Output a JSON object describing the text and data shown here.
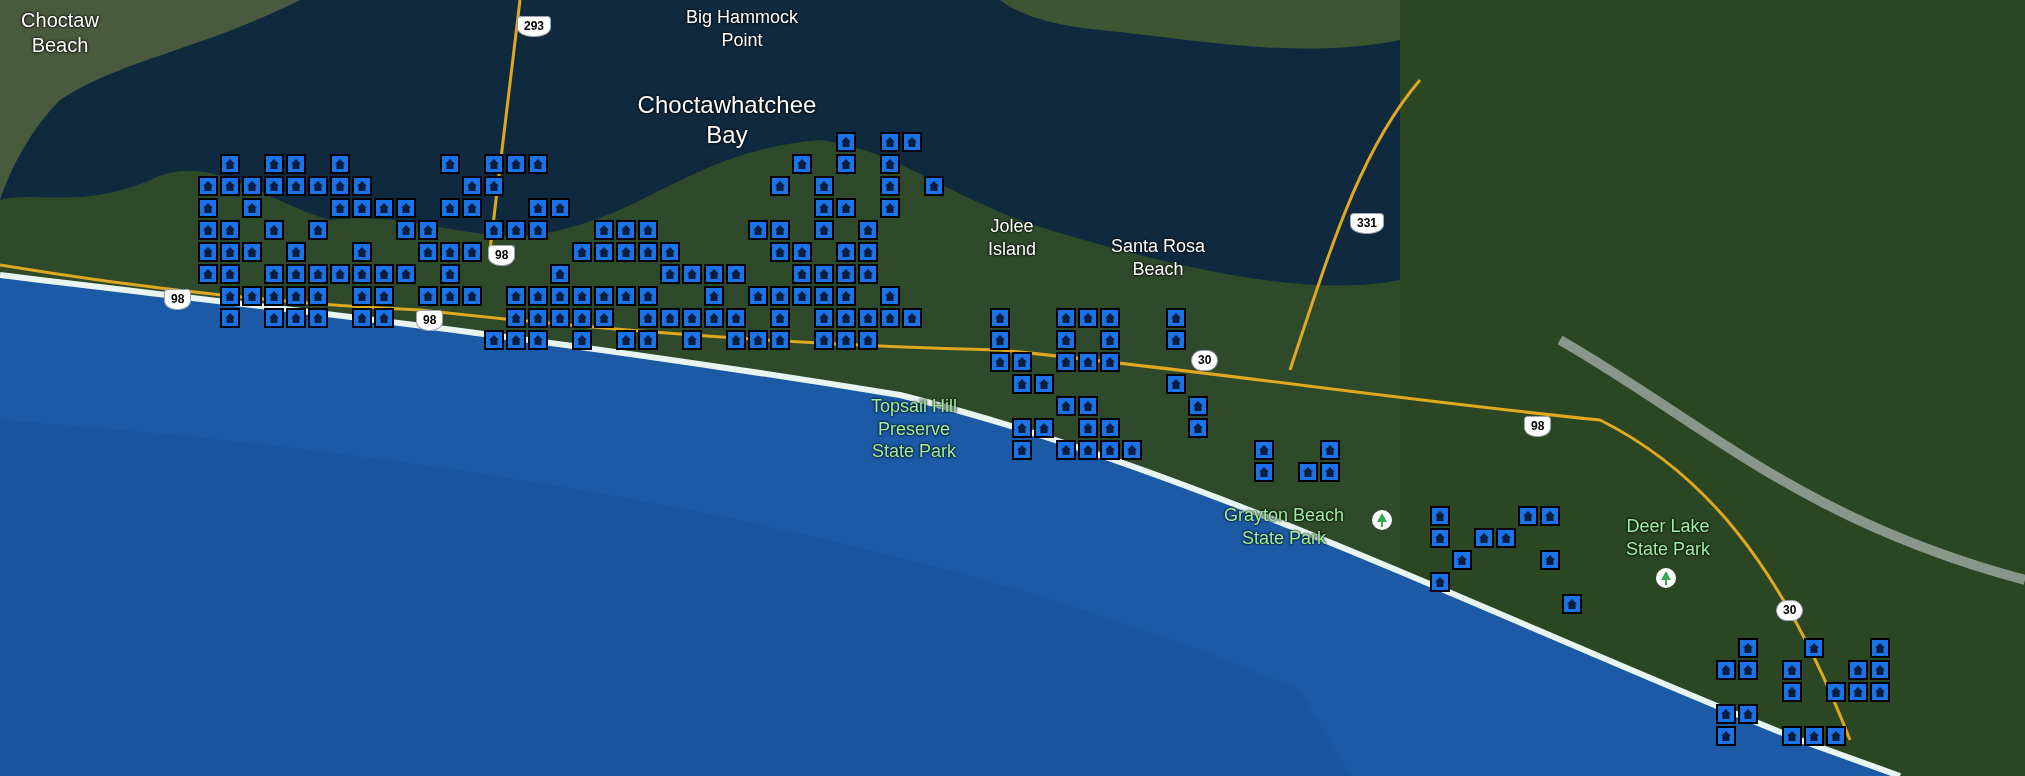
{
  "map": {
    "labels": [
      {
        "kind": "place",
        "lines": [
          "Choctaw",
          "Beach"
        ]
      },
      {
        "kind": "place",
        "lines": [
          "Big Hammock",
          "Point"
        ]
      },
      {
        "kind": "place",
        "lines": [
          "Choctawhatchee",
          "Bay"
        ]
      },
      {
        "kind": "place",
        "lines": [
          "Jolee",
          "Island"
        ]
      },
      {
        "kind": "place",
        "lines": [
          "Santa Rosa",
          "Beach"
        ]
      },
      {
        "kind": "park",
        "lines": [
          "Topsail Hill",
          "Preserve",
          "State Park"
        ]
      },
      {
        "kind": "park",
        "lines": [
          "Grayton Beach",
          "State Park"
        ]
      },
      {
        "kind": "park",
        "lines": [
          "Deer Lake",
          "State Park"
        ]
      }
    ],
    "shields": [
      {
        "kind": "us",
        "number": "293"
      },
      {
        "kind": "us",
        "number": "98"
      },
      {
        "kind": "us",
        "number": "98"
      },
      {
        "kind": "us",
        "number": "98"
      },
      {
        "kind": "us",
        "number": "331"
      },
      {
        "kind": "state",
        "number": "30"
      },
      {
        "kind": "us",
        "number": "98"
      },
      {
        "kind": "state",
        "number": "30"
      }
    ]
  }
}
